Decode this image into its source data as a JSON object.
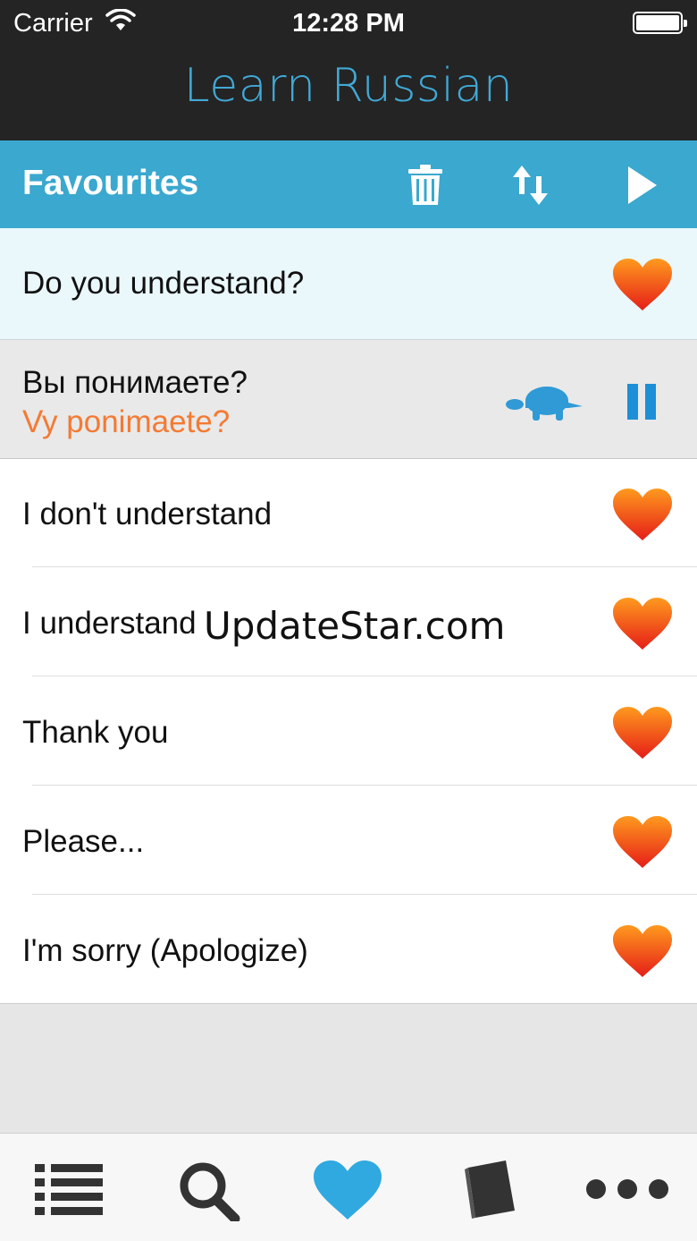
{
  "status_bar": {
    "carrier": "Carrier",
    "time": "12:28 PM"
  },
  "app": {
    "title": "Learn Russian"
  },
  "toolbar": {
    "title": "Favourites",
    "icons": [
      "trash-icon",
      "sort-icon",
      "play-icon"
    ]
  },
  "phrases": {
    "selected": {
      "english": "Do you understand?",
      "russian": "Вы понимаете?",
      "transliteration": "Vy ponimaete?"
    },
    "items": [
      {
        "label": "I don't understand"
      },
      {
        "label": "I understand"
      },
      {
        "label": "Thank you"
      },
      {
        "label": "Please..."
      },
      {
        "label": "I'm sorry (Apologize)"
      }
    ]
  },
  "watermark": "UpdateStar.com",
  "tabbar": {
    "tabs": [
      "list-icon",
      "search-icon",
      "heart-icon",
      "book-icon",
      "more-icon"
    ],
    "active": "heart-icon"
  },
  "colors": {
    "accent": "#3aa8cf",
    "title_blue": "#41a9d6",
    "transliteration": "#f47a33",
    "heart_top": "#ff8a1c",
    "heart_bottom": "#e8201a",
    "header_bg": "#242424"
  }
}
